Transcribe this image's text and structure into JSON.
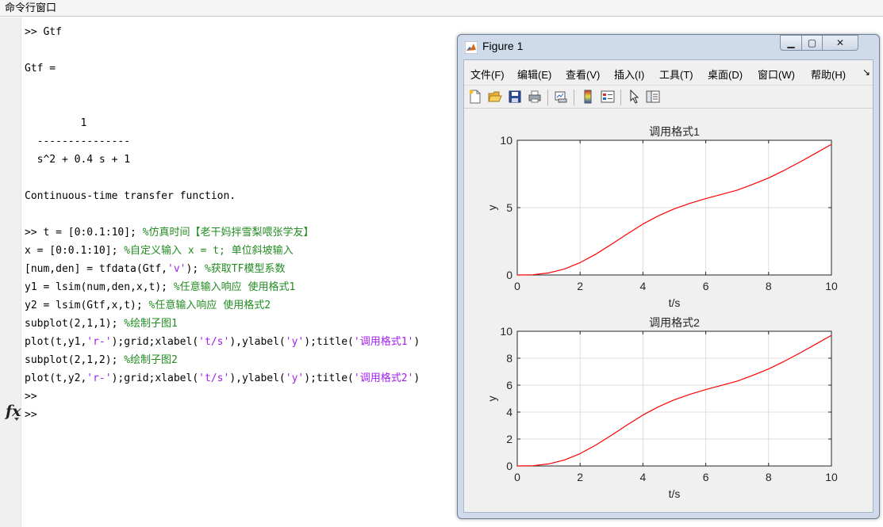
{
  "command_window": {
    "title": "命令行窗口",
    "lines": [
      [
        {
          "t": ">> Gtf"
        }
      ],
      [],
      [
        {
          "t": "Gtf ="
        }
      ],
      [],
      [],
      [
        {
          "t": "         1"
        }
      ],
      [
        {
          "t": "  ---------------"
        }
      ],
      [
        {
          "t": "  s^2 + 0.4 s + 1"
        }
      ],
      [],
      [
        {
          "t": "Continuous-time transfer function."
        }
      ],
      [],
      [
        {
          "t": ">> t = [0:0.1:10]; "
        },
        {
          "t": "%仿真时间【老干妈拌雪梨喂张学友】",
          "c": "cm"
        }
      ],
      [
        {
          "t": "x = [0:0.1:10]; "
        },
        {
          "t": "%自定义输入 x = t; 单位斜坡输入",
          "c": "cm"
        }
      ],
      [
        {
          "t": "[num,den] = tfdata(Gtf,"
        },
        {
          "t": "'v'",
          "c": "st"
        },
        {
          "t": "); "
        },
        {
          "t": "%获取TF模型系数",
          "c": "cm"
        }
      ],
      [
        {
          "t": "y1 = lsim(num,den,x,t); "
        },
        {
          "t": "%任意输入响应 使用格式1",
          "c": "cm"
        }
      ],
      [
        {
          "t": "y2 = lsim(Gtf,x,t); "
        },
        {
          "t": "%任意输入响应 使用格式2",
          "c": "cm"
        }
      ],
      [
        {
          "t": "subplot(2,1,1); "
        },
        {
          "t": "%绘制子图1",
          "c": "cm"
        }
      ],
      [
        {
          "t": "plot(t,y1,"
        },
        {
          "t": "'r-'",
          "c": "st"
        },
        {
          "t": ");grid;xlabel("
        },
        {
          "t": "'t/s'",
          "c": "st"
        },
        {
          "t": "),ylabel("
        },
        {
          "t": "'y'",
          "c": "st"
        },
        {
          "t": ");title("
        },
        {
          "t": "'调用格式1'",
          "c": "st"
        },
        {
          "t": ")"
        }
      ],
      [
        {
          "t": "subplot(2,1,2); "
        },
        {
          "t": "%绘制子图2",
          "c": "cm"
        }
      ],
      [
        {
          "t": "plot(t,y2,"
        },
        {
          "t": "'r-'",
          "c": "st"
        },
        {
          "t": ");grid;xlabel("
        },
        {
          "t": "'t/s'",
          "c": "st"
        },
        {
          "t": "),ylabel("
        },
        {
          "t": "'y'",
          "c": "st"
        },
        {
          "t": ");title("
        },
        {
          "t": "'调用格式2'",
          "c": "st"
        },
        {
          "t": ")"
        }
      ],
      [
        {
          "t": ">>"
        }
      ],
      [
        {
          "t": ">>"
        }
      ]
    ],
    "fx_icon": "fx-icon"
  },
  "figure": {
    "title": "Figure 1",
    "menus": [
      "文件(F)",
      "编辑(E)",
      "查看(V)",
      "插入(I)",
      "工具(T)",
      "桌面(D)",
      "窗口(W)",
      "帮助(H)"
    ],
    "menu_overflow": "↘",
    "toolbar_icons": [
      "new-figure-icon",
      "open-file-icon",
      "save-icon",
      "print-icon",
      "link-plot-icon",
      "colorbar-icon",
      "legend-icon",
      "pointer-icon",
      "property-editor-icon"
    ],
    "colors": {
      "line": "#ff0000",
      "grid": "#dfdfdf",
      "axes_bg": "#ffffff",
      "figure_bg": "#f0f0f0"
    }
  },
  "chart_data": [
    {
      "type": "line",
      "title": "调用格式1",
      "xlabel": "t/s",
      "ylabel": "y",
      "xlim": [
        0,
        10
      ],
      "ylim": [
        0,
        10
      ],
      "xticks": [
        "0",
        "2",
        "4",
        "6",
        "8",
        "10"
      ],
      "yticks": [
        "0",
        "5",
        "10"
      ],
      "grid": true,
      "series": [
        {
          "x": [
            0,
            0.5,
            1,
            1.5,
            2,
            2.5,
            3,
            3.5,
            4,
            4.5,
            5,
            5.5,
            6,
            6.5,
            7,
            7.5,
            8,
            8.5,
            9,
            9.5,
            10
          ],
          "values": [
            0,
            0.02,
            0.15,
            0.45,
            0.92,
            1.55,
            2.28,
            3.05,
            3.78,
            4.4,
            4.92,
            5.32,
            5.67,
            5.98,
            6.3,
            6.73,
            7.2,
            7.77,
            8.39,
            9.04,
            9.7
          ]
        }
      ]
    },
    {
      "type": "line",
      "title": "调用格式2",
      "xlabel": "t/s",
      "ylabel": "y",
      "xlim": [
        0,
        10
      ],
      "ylim": [
        0,
        10
      ],
      "xticks": [
        "0",
        "2",
        "4",
        "6",
        "8",
        "10"
      ],
      "yticks": [
        "0",
        "2",
        "4",
        "6",
        "8",
        "10"
      ],
      "grid": true,
      "series": [
        {
          "x": [
            0,
            0.5,
            1,
            1.5,
            2,
            2.5,
            3,
            3.5,
            4,
            4.5,
            5,
            5.5,
            6,
            6.5,
            7,
            7.5,
            8,
            8.5,
            9,
            9.5,
            10
          ],
          "values": [
            0,
            0.02,
            0.15,
            0.45,
            0.92,
            1.55,
            2.28,
            3.05,
            3.78,
            4.4,
            4.92,
            5.32,
            5.67,
            5.98,
            6.3,
            6.73,
            7.2,
            7.77,
            8.39,
            9.04,
            9.7
          ]
        }
      ]
    }
  ]
}
